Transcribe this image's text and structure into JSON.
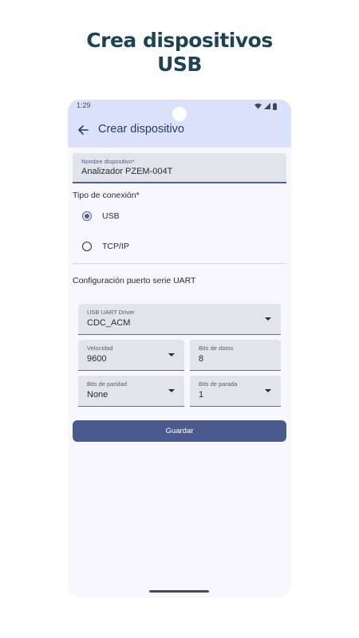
{
  "promo": {
    "line1": "Crea dispositivos",
    "line2": "USB"
  },
  "status_bar": {
    "time": "1:29",
    "icons": [
      "wifi-icon",
      "signal-icon",
      "battery-icon"
    ]
  },
  "app_bar": {
    "back_icon": "arrow-left-icon",
    "title": "Crear dispositivo"
  },
  "form": {
    "device_name": {
      "label": "Nombre dispositivo*",
      "value": "Analizador PZEM-004T"
    },
    "connection": {
      "label": "Tipo de conexión*",
      "options": [
        {
          "label": "USB",
          "selected": true
        },
        {
          "label": "TCP/IP",
          "selected": false
        }
      ]
    },
    "uart": {
      "section_title": "Configuración puerto serie UART",
      "driver": {
        "label": "USB UART Driver",
        "value": "CDC_ACM"
      },
      "baud": {
        "label": "Velocidad",
        "value": "9600"
      },
      "data_bits": {
        "label": "Bits de datos",
        "value": "8"
      },
      "parity": {
        "label": "Bits de paridad",
        "value": "None"
      },
      "stop_bits": {
        "label": "Bits de parada",
        "value": "1"
      }
    },
    "save_label": "Guardar"
  },
  "colors": {
    "accent": "#4b5a8e",
    "app_bar": "#dbe1fa",
    "headline": "#1f4352"
  }
}
